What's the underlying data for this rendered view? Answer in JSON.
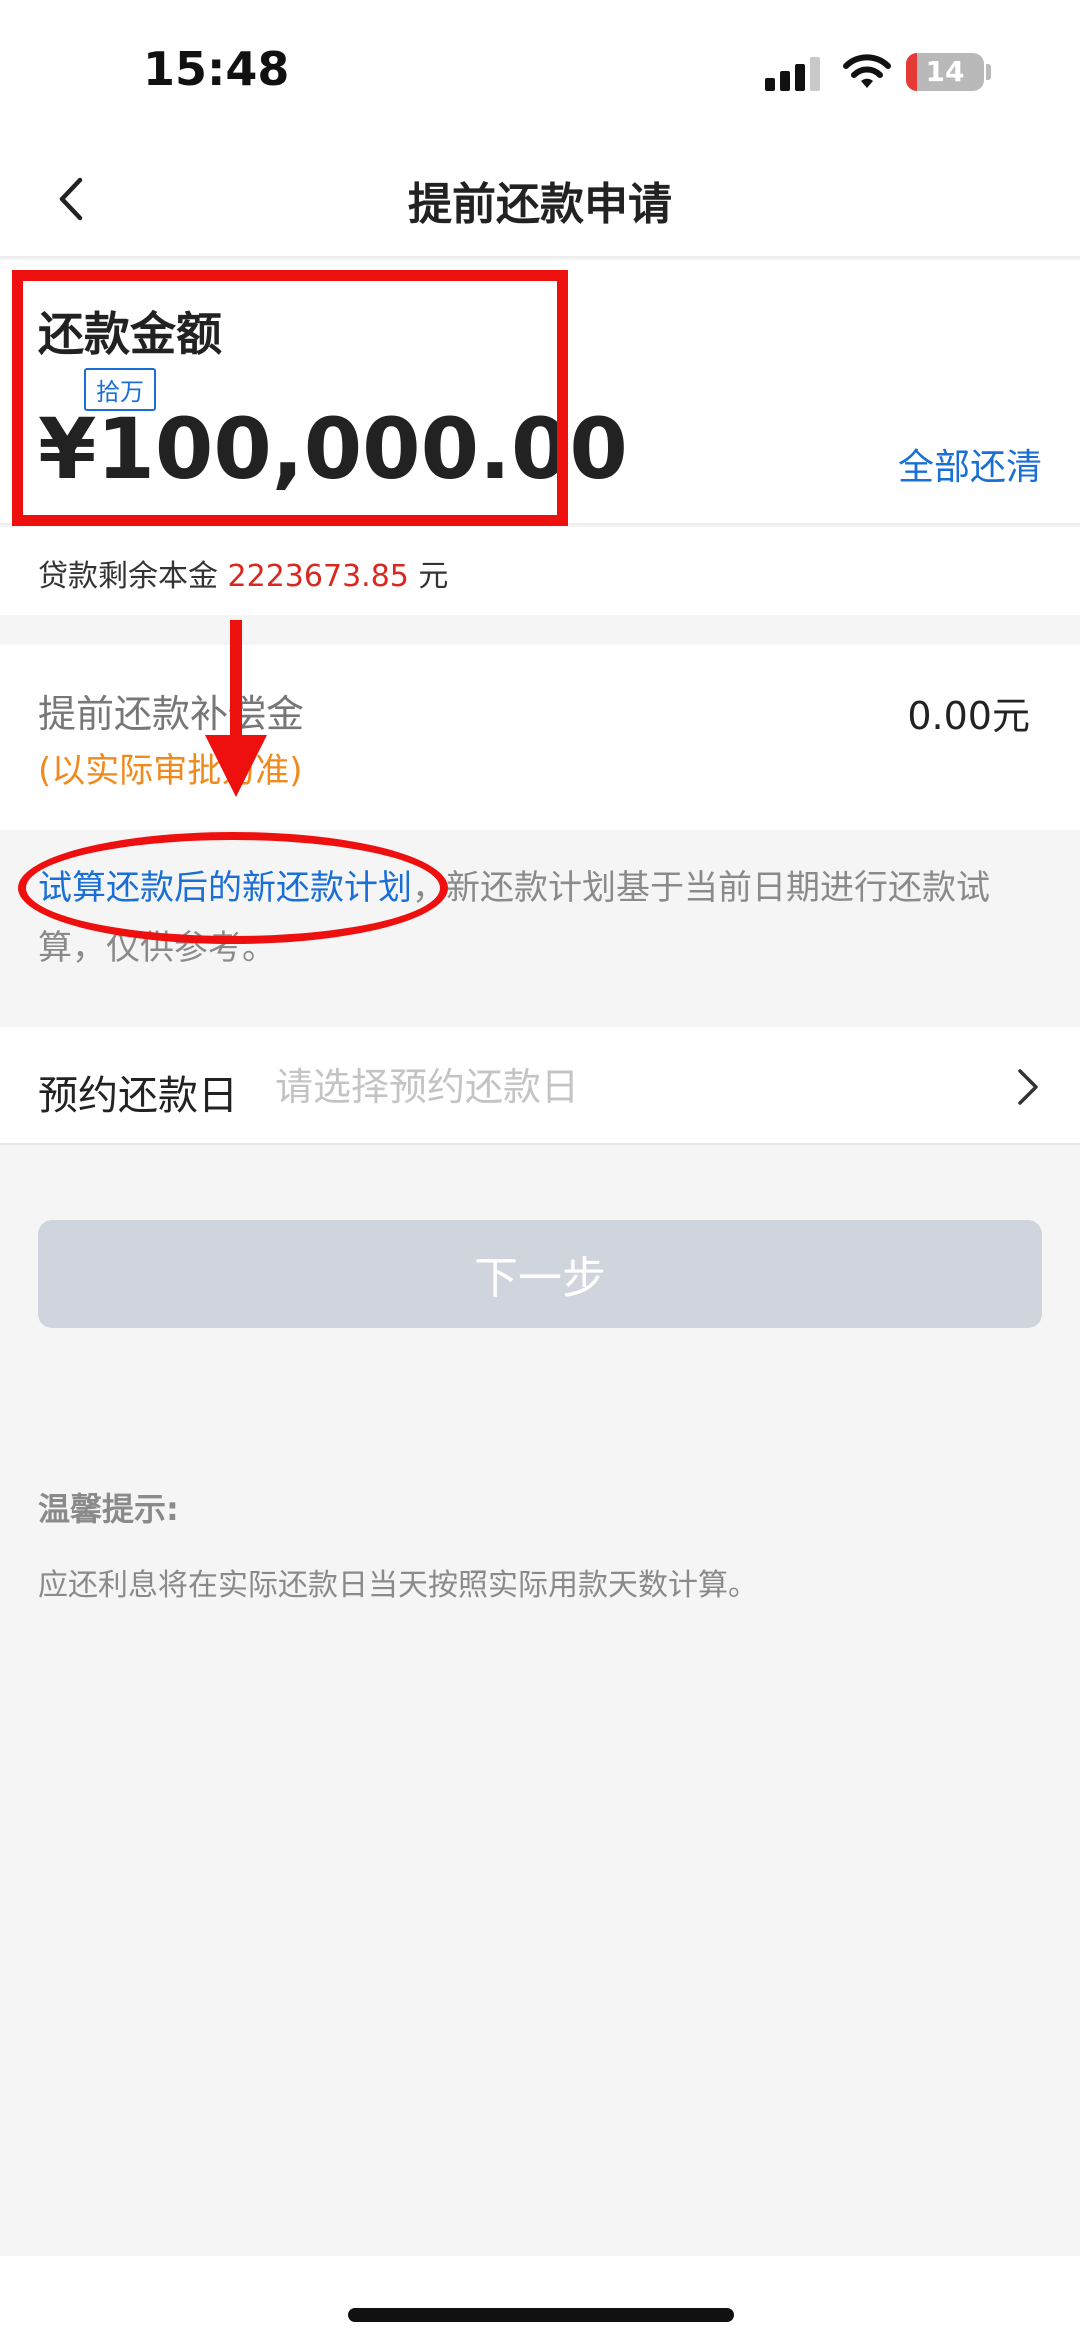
{
  "status_bar": {
    "time": "15:48",
    "battery": "14",
    "battery_level": 0.14
  },
  "header": {
    "title": "提前还款申请",
    "back_icon": "chevron-left-icon"
  },
  "amount": {
    "label": "还款金额",
    "unit_hint": "拾万",
    "value": "¥100,000.00",
    "pay_all_label": "全部还清"
  },
  "remaining": {
    "prefix": "贷款剩余本金 ",
    "amount": "2223673.85",
    "suffix": " 元"
  },
  "compensation": {
    "label": "提前还款补偿金",
    "note": "(以实际审批为准)",
    "value": "0.00元"
  },
  "schedule_info": {
    "link_text": "试算还款后的新还款计划",
    "body_text": "，新还款计划基于当前日期进行还款试算，仅供参考。"
  },
  "reservation": {
    "label": "预约还款日",
    "placeholder": "请选择预约还款日",
    "chevron_icon": "chevron-right-icon"
  },
  "next_button": {
    "label": "下一步"
  },
  "tips": {
    "title": "温馨提示:",
    "body": "应还利息将在实际还款日当天按照实际用款天数计算。"
  },
  "colors": {
    "link": "#1a6fd6",
    "red_accent": "#d8281f",
    "note_orange": "#f08a1c",
    "button_disabled": "#d0d5dd",
    "annotation_red": "#ee0f0f"
  }
}
